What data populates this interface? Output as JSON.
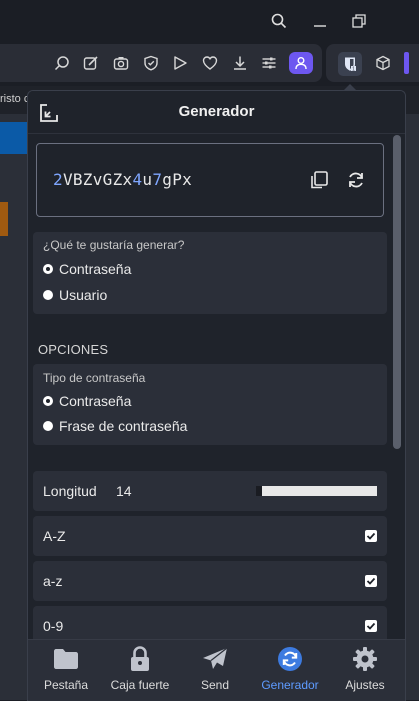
{
  "browser": {
    "bookmark_fragment": "risto c",
    "icons": [
      "search-icon",
      "minimize-icon",
      "restore-icon",
      "zoom-icon",
      "edit-icon",
      "camera-icon",
      "shield-icon",
      "play-icon",
      "heart-icon",
      "download-icon",
      "settings-sliders-icon",
      "profile-icon",
      "bitwarden-icon",
      "cube-icon"
    ],
    "accent_color": "#6d57f0"
  },
  "popup": {
    "title": "Generador",
    "password": {
      "parts": [
        {
          "text": "2",
          "digit": true
        },
        {
          "text": "VBZvGZx",
          "digit": false
        },
        {
          "text": "4",
          "digit": true
        },
        {
          "text": "u",
          "digit": false
        },
        {
          "text": "7",
          "digit": true
        },
        {
          "text": "gPx",
          "digit": false
        }
      ]
    },
    "generate_question": "¿Qué te gustaría generar?",
    "type_options": [
      {
        "label": "Contraseña",
        "checked": true
      },
      {
        "label": "Usuario",
        "checked": false
      }
    ],
    "options_title": "OPCIONES",
    "password_type_label": "Tipo de contraseña",
    "password_type_options": [
      {
        "label": "Contraseña",
        "checked": true
      },
      {
        "label": "Frase de contraseña",
        "checked": false
      }
    ],
    "length": {
      "label": "Longitud",
      "value": "14",
      "fraction": 0.1
    },
    "charsets": [
      {
        "label": "A-Z",
        "checked": true
      },
      {
        "label": "a-z",
        "checked": true
      },
      {
        "label": "0-9",
        "checked": true
      }
    ],
    "nav": [
      {
        "label": "Pestaña",
        "icon": "folder-icon",
        "active": false
      },
      {
        "label": "Caja fuerte",
        "icon": "lock-icon",
        "active": false
      },
      {
        "label": "Send",
        "icon": "send-icon",
        "active": false
      },
      {
        "label": "Generador",
        "icon": "generator-icon",
        "active": true
      },
      {
        "label": "Ajustes",
        "icon": "gear-icon",
        "active": false
      }
    ],
    "colors": {
      "active": "#5e9bff",
      "digit": "#7fa6ff"
    }
  }
}
